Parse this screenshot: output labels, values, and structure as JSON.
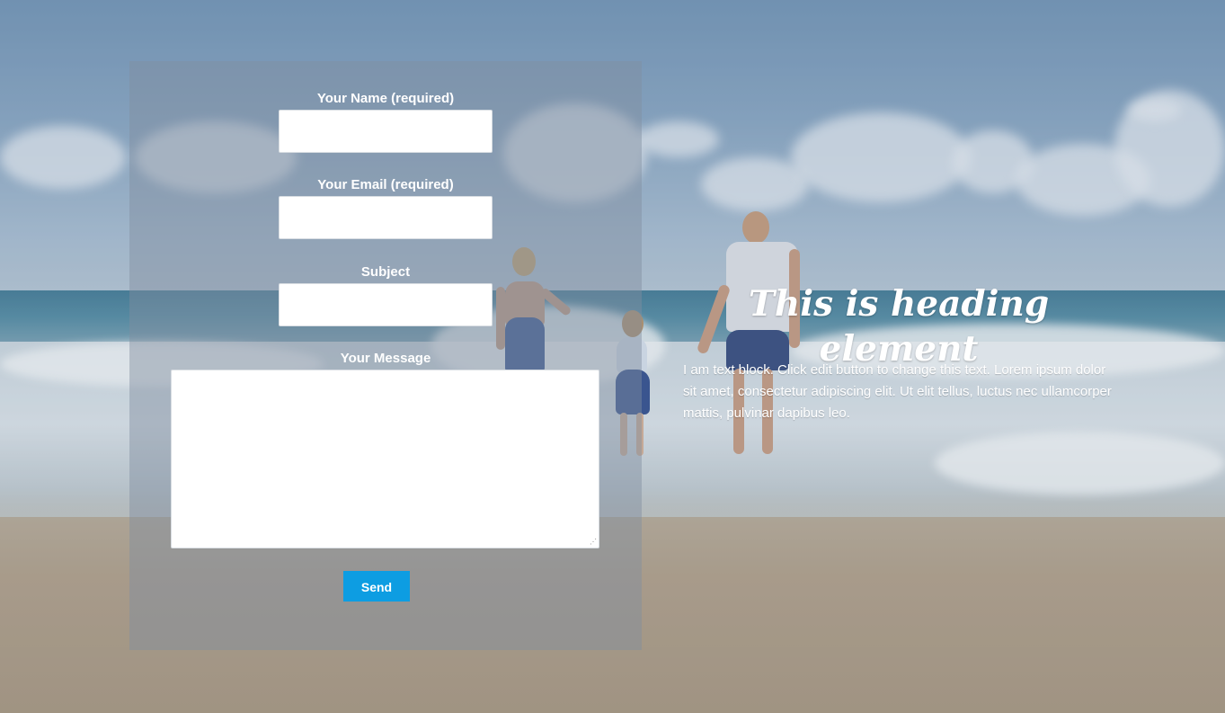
{
  "contact_form": {
    "name_label": "Your Name (required)",
    "name_value": "",
    "email_label": "Your Email (required)",
    "email_value": "",
    "subject_label": "Subject",
    "subject_value": "",
    "message_label": "Your Message",
    "message_value": "",
    "send_label": "Send"
  },
  "content": {
    "heading": "This is heading element",
    "text_block": "I am text block. Click edit button to change this text. Lorem ipsum dolor sit amet, consectetur adipiscing elit. Ut elit tellus, luctus nec ullamcorper mattis, pulvinar dapibus leo."
  },
  "colors": {
    "send_button": "#0d9de2",
    "panel_overlay": "rgba(128,142,160,0.45)"
  }
}
